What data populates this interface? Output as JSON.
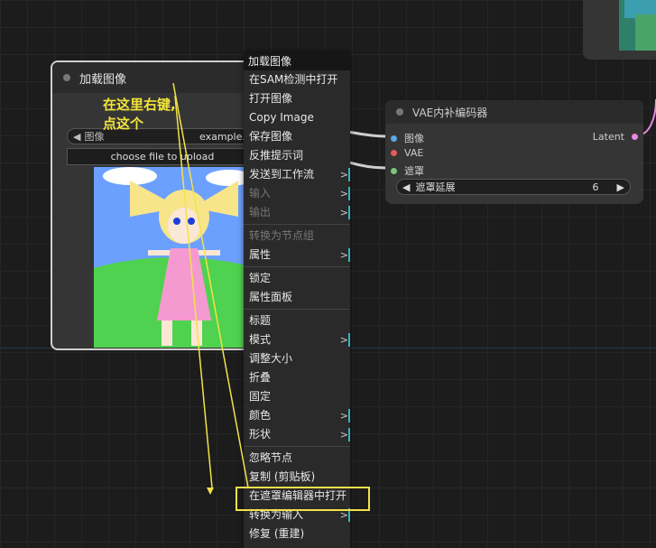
{
  "load_node": {
    "title": "加载图像",
    "image_widget_label": "图像",
    "image_widget_value": "example.png",
    "upload_label": "choose file to upload"
  },
  "vae_node": {
    "title": "VAE内补编码器",
    "inputs": [
      {
        "label": "图像",
        "color": "#5aa8e8"
      },
      {
        "label": "VAE",
        "color": "#e85a5a"
      },
      {
        "label": "遮罩",
        "color": "#7cc77c"
      }
    ],
    "output_label": "Latent",
    "output_color": "#e88ae0",
    "widget_label": "遮罩延展",
    "widget_value": "6"
  },
  "annotation": {
    "line1": "在这里右键,",
    "line2": "点这个"
  },
  "menu": {
    "title": "加载图像",
    "sections": [
      [
        {
          "label": "在SAM检测中打开"
        },
        {
          "label": "打开图像"
        },
        {
          "label": "Copy Image"
        },
        {
          "label": "保存图像"
        },
        {
          "label": "反推提示词"
        },
        {
          "label": "发送到工作流",
          "submenu": true
        },
        {
          "label": "输入",
          "submenu": true,
          "disabled": true
        },
        {
          "label": "输出",
          "submenu": true,
          "disabled": true
        }
      ],
      [
        {
          "label": "转换为节点组",
          "disabled": true
        },
        {
          "label": "属性",
          "submenu": true
        }
      ],
      [
        {
          "label": "锁定"
        },
        {
          "label": "属性面板"
        }
      ],
      [
        {
          "label": "标题"
        },
        {
          "label": "模式",
          "submenu": true
        },
        {
          "label": "调整大小"
        },
        {
          "label": "折叠"
        },
        {
          "label": "固定"
        },
        {
          "label": "颜色",
          "submenu": true
        },
        {
          "label": "形状",
          "submenu": true
        }
      ],
      [
        {
          "label": "忽略节点"
        },
        {
          "label": "复制 (剪贴板)"
        },
        {
          "label": "在遮罩编辑器中打开"
        },
        {
          "label": "转换为输入",
          "submenu": true
        },
        {
          "label": "修复 (重建)"
        }
      ]
    ],
    "submenu_glyph": ">"
  },
  "colors": {
    "highlight": "#f2e24a",
    "annotation": "#f3e53a",
    "submenu_marker": "#35b5c0"
  }
}
